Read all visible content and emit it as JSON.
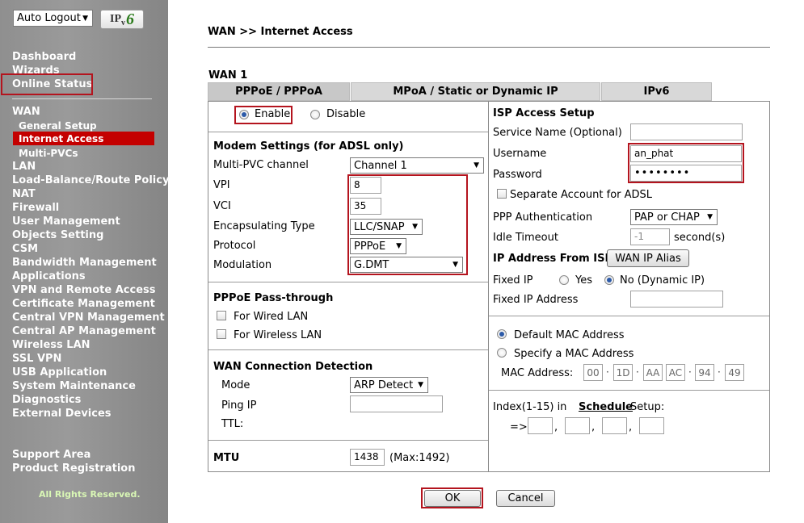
{
  "sidebar": {
    "auto_logout": "Auto Logout",
    "logo_text_ip": "IP",
    "logo_text_v": "v",
    "logo_text_six": "6",
    "menu": {
      "dashboard": "Dashboard",
      "wizards": "Wizards",
      "online_status": "Online Status",
      "wan": "WAN",
      "general_setup": "General Setup",
      "internet_access": "Internet Access",
      "multi_pvcs": "Multi-PVCs",
      "lan": "LAN",
      "load_balance": "Load-Balance/Route Policy",
      "nat": "NAT",
      "firewall": "Firewall",
      "user_management": "User Management",
      "objects_setting": "Objects Setting",
      "csm": "CSM",
      "bandwidth_management": "Bandwidth Management",
      "applications": "Applications",
      "vpn": "VPN and Remote Access",
      "certificate": "Certificate Management",
      "central_vpn": "Central VPN Management",
      "central_ap": "Central AP Management",
      "wireless_lan": "Wireless LAN",
      "ssl_vpn": "SSL VPN",
      "usb_application": "USB Application",
      "system_maintenance": "System Maintenance",
      "diagnostics": "Diagnostics",
      "external_devices": "External Devices",
      "support_area": "Support Area",
      "product_registration": "Product Registration"
    },
    "all_rights": "All Rights Reserved."
  },
  "main": {
    "breadcrumb": "WAN >> Internet Access",
    "wan_label": "WAN 1",
    "tabs": [
      {
        "label": "PPPoE / PPPoA",
        "active": true
      },
      {
        "label": "MPoA / Static or Dynamic IP",
        "active": false
      },
      {
        "label": "IPv6",
        "active": false
      }
    ],
    "left": {
      "enable": "Enable",
      "disable": "Disable",
      "modem_heading": "Modem Settings (for ADSL only)",
      "multi_pvc_label": "Multi-PVC channel",
      "multi_pvc_value": "Channel 1",
      "vpi_label": "VPI",
      "vpi_value": "8",
      "vci_label": "VCI",
      "vci_value": "35",
      "encap_label": "Encapsulating Type",
      "encap_value": "LLC/SNAP",
      "protocol_label": "Protocol",
      "protocol_value": "PPPoE",
      "modulation_label": "Modulation",
      "modulation_value": "G.DMT",
      "passthrough_heading": "PPPoE Pass-through",
      "wired_lan": "For Wired LAN",
      "wireless_lan": "For Wireless LAN",
      "detection_heading": "WAN Connection Detection",
      "mode_label": "Mode",
      "mode_value": "ARP Detect",
      "ping_ip_label": "Ping IP",
      "ping_ip_value": "",
      "ttl_label": "TTL:",
      "mtu_label": "MTU",
      "mtu_value": "1438",
      "mtu_max": "(Max:1492)"
    },
    "right": {
      "isp_heading": "ISP Access Setup",
      "service_name_label": "Service Name (Optional)",
      "service_name_value": "",
      "username_label": "Username",
      "username_value": "an_phat",
      "password_label": "Password",
      "password_value": "••••••••",
      "separate_account": "Separate Account for ADSL",
      "ppp_auth_label": "PPP Authentication",
      "ppp_auth_value": "PAP or CHAP",
      "idle_timeout_label": "Idle Timeout",
      "idle_timeout_value": "-1",
      "idle_timeout_unit": "second(s)",
      "ip_from_isp": "IP Address From ISP",
      "wan_ip_alias": "WAN IP Alias",
      "fixed_ip_label": "Fixed IP",
      "yes": "Yes",
      "no_dynamic": "No (Dynamic IP)",
      "fixed_ip_address_label": "Fixed IP Address",
      "fixed_ip_address_value": "",
      "default_mac": "Default MAC Address",
      "specify_mac": "Specify a MAC Address",
      "mac_label": "MAC Address:",
      "mac_octets": [
        "00",
        "1D",
        "AA",
        "AC",
        "94",
        "49"
      ],
      "mac_sep": "·",
      "index_text": "Index(1-15) in",
      "schedule_link": "Schedule",
      "setup_text": "Setup:",
      "arrow": "=>",
      "comma": ","
    },
    "ok": "OK",
    "cancel": "Cancel"
  },
  "colors": {
    "highlight_red": "#c40000",
    "annotation_red": "#b4141e",
    "sidebar_gray": "#999999",
    "tab_gray": "#d8d8d8"
  },
  "icons": {
    "dropdown": "▾"
  }
}
